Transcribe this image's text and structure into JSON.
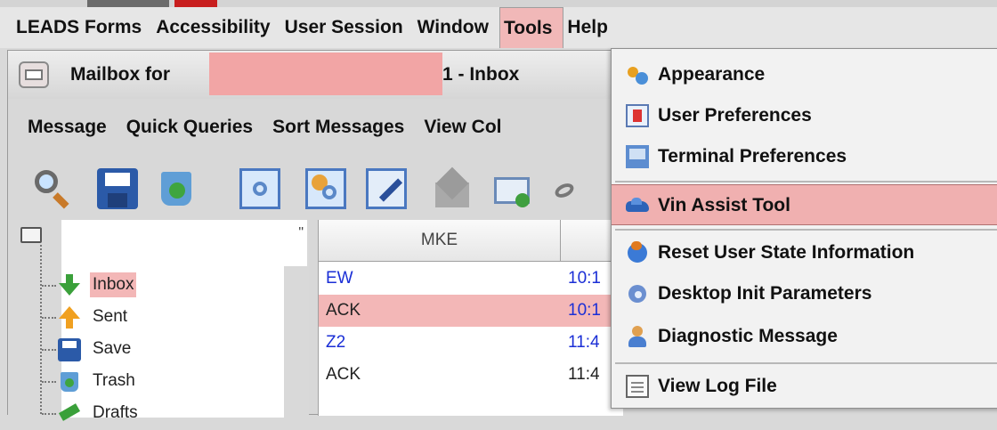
{
  "menubar": {
    "items": [
      {
        "label": "LEADS Forms",
        "active": false
      },
      {
        "label": "Accessibility",
        "active": false
      },
      {
        "label": "User Session",
        "active": false
      },
      {
        "label": "Window",
        "active": false
      },
      {
        "label": "Tools",
        "active": true
      },
      {
        "label": "Help",
        "active": false
      }
    ]
  },
  "mailbox": {
    "title_prefix": "Mailbox for",
    "title_suffix": "1 - Inbox",
    "menu": [
      "Message",
      "Quick Queries",
      "Sort Messages",
      "View Col"
    ],
    "toolbar_icons": [
      "search-icon",
      "save-icon",
      "trash-icon",
      "window-search-icon",
      "window-people-icon",
      "compose-icon",
      "disabled-icon",
      "send-mail-icon",
      "glasses-icon"
    ],
    "tree": {
      "items": [
        {
          "label": "Inbox",
          "icon": "inbox-arrow-icon",
          "selected": true
        },
        {
          "label": "Sent",
          "icon": "sent-arrow-icon",
          "selected": false
        },
        {
          "label": "Save",
          "icon": "floppy-icon",
          "selected": false
        },
        {
          "label": "Trash",
          "icon": "trash-icon",
          "selected": false
        },
        {
          "label": "Drafts",
          "icon": "drafts-icon",
          "selected": false
        }
      ]
    },
    "table": {
      "column_header": "MKE",
      "rows": [
        {
          "code": "EW",
          "time": "10:1",
          "color": "#1b2fd6",
          "selected": false
        },
        {
          "code": "ACK",
          "time": "10:1",
          "color": "#222222",
          "selected": true
        },
        {
          "code": "Z2",
          "time": "11:4",
          "color": "#1b2fd6",
          "selected": false
        },
        {
          "code": "ACK",
          "time": "11:4",
          "color": "#222222",
          "selected": false
        }
      ]
    }
  },
  "tools_menu": {
    "items": [
      {
        "label": "Appearance",
        "icon": "appearance-icon",
        "highlighted": false
      },
      {
        "label": "User Preferences",
        "icon": "user-preferences-icon",
        "highlighted": false
      },
      {
        "label": "Terminal Preferences",
        "icon": "terminal-preferences-icon",
        "highlighted": false
      },
      {
        "label": "Vin Assist Tool",
        "icon": "vin-assist-car-icon",
        "highlighted": true
      },
      {
        "label": "Reset User State Information",
        "icon": "reset-globe-icon",
        "highlighted": false
      },
      {
        "label": "Desktop Init Parameters",
        "icon": "desktop-init-icon",
        "highlighted": false
      },
      {
        "label": "Diagnostic Message",
        "icon": "diagnostic-user-icon",
        "highlighted": false
      },
      {
        "label": "View Log File",
        "icon": "log-file-icon",
        "highlighted": false
      }
    ]
  },
  "colors": {
    "highlight": "#f0b0b0",
    "selection": "#f3b7b7",
    "redaction": "#f2a5a5",
    "link_blue": "#1b2fd6"
  }
}
